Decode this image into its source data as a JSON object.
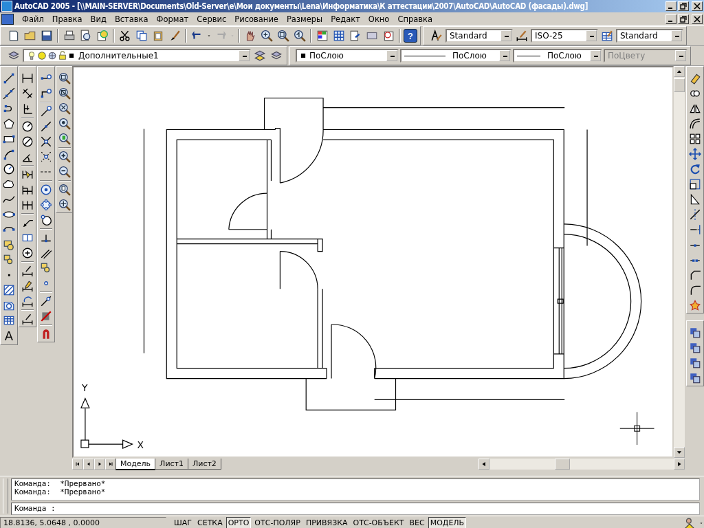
{
  "window": {
    "title": "AutoCAD 2005 - [\\\\MAIN-SERVER\\Documents\\Old-Server\\e\\Мои документы\\Lena\\Информатика\\К аттестации\\2007\\AutoCAD\\AutoCAD (фасады).dwg]"
  },
  "menu": [
    "Файл",
    "Правка",
    "Вид",
    "Вставка",
    "Формат",
    "Сервис",
    "Рисование",
    "Размеры",
    "Редакт",
    "Окно",
    "Справка"
  ],
  "standard_toolbar": {
    "help_label": "?",
    "text_style": "Standard",
    "dim_style": "ISO-25",
    "table_style": "Standard"
  },
  "layers_toolbar": {
    "layer": "Дополнительные1",
    "color_setting": "ПоСлою",
    "linetype": "ПоСлою",
    "lineweight": "ПоСлою",
    "plot_style": {
      "value": "ПоЦвету",
      "disabled": true
    }
  },
  "draw_toolbar": {
    "text_tool": "A"
  },
  "ucs": {
    "x": "X",
    "y": "Y"
  },
  "layout_tabs": [
    {
      "label": "Модель",
      "selected": true
    },
    {
      "label": "Лист1",
      "selected": false
    },
    {
      "label": "Лист2",
      "selected": false
    }
  ],
  "command_history": [
    "Команда:  *Прервано*",
    "Команда:  *Прервано*"
  ],
  "command_prompt": "Команда :",
  "status_bar": {
    "coordinates": "18.8136, 5.0648 , 0.0000",
    "toggles": [
      {
        "label": "ШАГ",
        "on": false
      },
      {
        "label": "СЕТКА",
        "on": false
      },
      {
        "label": "ОРТО",
        "on": true
      },
      {
        "label": "ОТС-ПОЛЯР",
        "on": false
      },
      {
        "label": "ПРИВЯЗКА",
        "on": false
      },
      {
        "label": "ОТС-ОБЪЕКТ",
        "on": false
      },
      {
        "label": "ВЕС",
        "on": false
      },
      {
        "label": "МОДЕЛЬ",
        "on": true
      }
    ]
  }
}
